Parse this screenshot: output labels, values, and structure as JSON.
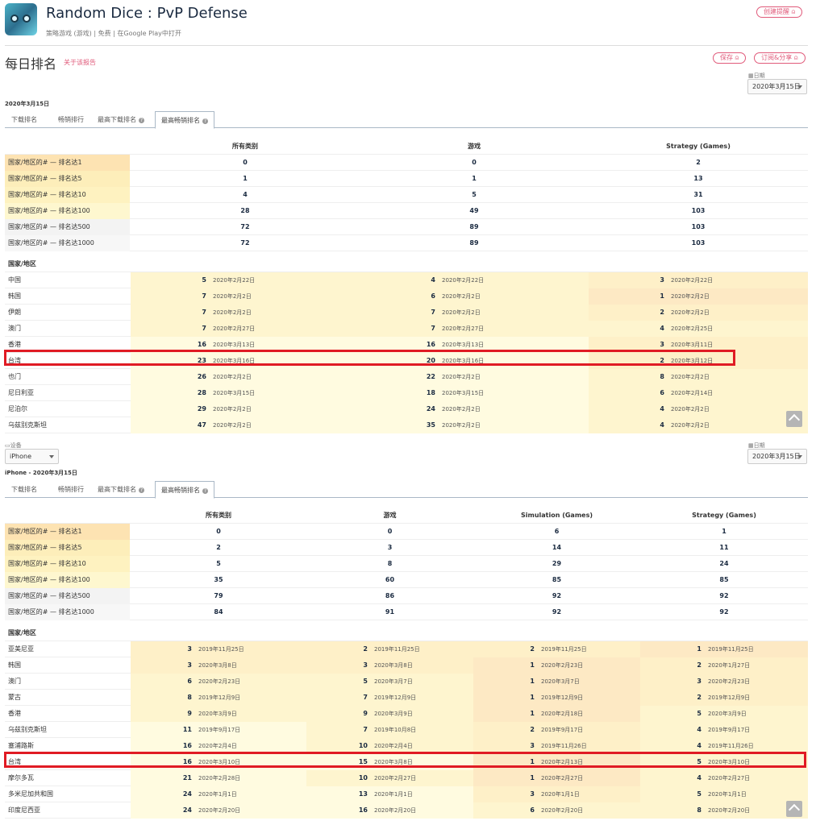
{
  "app": {
    "title": "Random Dice : PvP Defense",
    "category": "策略游戏 (游戏)",
    "price": "免费",
    "store_link": "在Google Play中打开",
    "create_alert": "创建提醒 ⍝"
  },
  "page": {
    "title": "每日排名",
    "about": "关于该报告",
    "save": "保存 ⍝",
    "subscribe": "订阅&分享 ⍝",
    "date_label": "日期",
    "date_value": "2020年3月15日"
  },
  "colors": {
    "accent": "#e05a7a",
    "highlight_box": "#e01b24"
  },
  "tab_labels": [
    "下载排名",
    "畅销排行",
    "最高下载排名",
    "最高畅销排名"
  ],
  "section1": {
    "date": "2020年3月15日",
    "headers": [
      "所有类别",
      "游戏",
      "Strategy (Games)"
    ],
    "summary": [
      {
        "label": "国家/地区的# — 排名达1",
        "values": [
          "0",
          "0",
          "2"
        ]
      },
      {
        "label": "国家/地区的# — 排名达5",
        "values": [
          "1",
          "1",
          "13"
        ]
      },
      {
        "label": "国家/地区的# — 排名达10",
        "values": [
          "4",
          "5",
          "31"
        ]
      },
      {
        "label": "国家/地区的# — 排名达100",
        "values": [
          "28",
          "49",
          "103"
        ]
      },
      {
        "label": "国家/地区的# — 排名达500",
        "values": [
          "72",
          "89",
          "103"
        ]
      },
      {
        "label": "国家/地区的# — 排名达1000",
        "values": [
          "72",
          "89",
          "103"
        ]
      }
    ],
    "country_label": "国家/地区",
    "countries": [
      {
        "name": "中国",
        "cells": [
          [
            "5",
            "2020年2月22日"
          ],
          [
            "4",
            "2020年2月22日"
          ],
          [
            "3",
            "2020年2月22日"
          ]
        ]
      },
      {
        "name": "韩国",
        "cells": [
          [
            "7",
            "2020年2月2日"
          ],
          [
            "6",
            "2020年2月2日"
          ],
          [
            "1",
            "2020年2月2日"
          ]
        ]
      },
      {
        "name": "伊朗",
        "cells": [
          [
            "7",
            "2020年2月2日"
          ],
          [
            "7",
            "2020年2月2日"
          ],
          [
            "2",
            "2020年2月2日"
          ]
        ]
      },
      {
        "name": "澳门",
        "cells": [
          [
            "7",
            "2020年2月27日"
          ],
          [
            "7",
            "2020年2月27日"
          ],
          [
            "4",
            "2020年2月25日"
          ]
        ]
      },
      {
        "name": "香港",
        "cells": [
          [
            "16",
            "2020年3月13日"
          ],
          [
            "16",
            "2020年3月13日"
          ],
          [
            "3",
            "2020年3月11日"
          ]
        ]
      },
      {
        "name": "台湾",
        "cells": [
          [
            "23",
            "2020年3月16日"
          ],
          [
            "20",
            "2020年3月16日"
          ],
          [
            "2",
            "2020年3月12日"
          ]
        ]
      },
      {
        "name": "也门",
        "cells": [
          [
            "26",
            "2020年2月2日"
          ],
          [
            "22",
            "2020年2月2日"
          ],
          [
            "8",
            "2020年2月2日"
          ]
        ]
      },
      {
        "name": "尼日利亚",
        "cells": [
          [
            "28",
            "2020年3月15日"
          ],
          [
            "18",
            "2020年3月15日"
          ],
          [
            "6",
            "2020年2月14日"
          ]
        ]
      },
      {
        "name": "尼泊尔",
        "cells": [
          [
            "29",
            "2020年2月2日"
          ],
          [
            "24",
            "2020年2月2日"
          ],
          [
            "4",
            "2020年2月2日"
          ]
        ]
      },
      {
        "name": "乌兹别克斯坦",
        "cells": [
          [
            "47",
            "2020年2月2日"
          ],
          [
            "35",
            "2020年2月2日"
          ],
          [
            "4",
            "2020年2月2日"
          ]
        ]
      }
    ]
  },
  "section2": {
    "device_label": "设备",
    "device_value": "iPhone",
    "date_label": "日期",
    "date_value": "2020年3月15日",
    "caption": "iPhone - 2020年3月15日",
    "headers": [
      "所有类别",
      "游戏",
      "Simulation (Games)",
      "Strategy (Games)"
    ],
    "summary": [
      {
        "label": "国家/地区的# — 排名达1",
        "values": [
          "0",
          "0",
          "6",
          "1"
        ]
      },
      {
        "label": "国家/地区的# — 排名达5",
        "values": [
          "2",
          "3",
          "14",
          "11"
        ]
      },
      {
        "label": "国家/地区的# — 排名达10",
        "values": [
          "5",
          "8",
          "29",
          "24"
        ]
      },
      {
        "label": "国家/地区的# — 排名达100",
        "values": [
          "35",
          "60",
          "85",
          "85"
        ]
      },
      {
        "label": "国家/地区的# — 排名达500",
        "values": [
          "79",
          "86",
          "92",
          "92"
        ]
      },
      {
        "label": "国家/地区的# — 排名达1000",
        "values": [
          "84",
          "91",
          "92",
          "92"
        ]
      }
    ],
    "country_label": "国家/地区",
    "countries": [
      {
        "name": "亚美尼亚",
        "cells": [
          [
            "3",
            "2019年11月25日"
          ],
          [
            "2",
            "2019年11月25日"
          ],
          [
            "2",
            "2019年11月25日"
          ],
          [
            "1",
            "2019年11月25日"
          ]
        ]
      },
      {
        "name": "韩国",
        "cells": [
          [
            "3",
            "2020年3月8日"
          ],
          [
            "3",
            "2020年3月8日"
          ],
          [
            "1",
            "2020年2月23日"
          ],
          [
            "2",
            "2020年1月27日"
          ]
        ]
      },
      {
        "name": "澳门",
        "cells": [
          [
            "6",
            "2020年2月23日"
          ],
          [
            "5",
            "2020年3月7日"
          ],
          [
            "1",
            "2020年3月7日"
          ],
          [
            "3",
            "2020年2月23日"
          ]
        ]
      },
      {
        "name": "蒙古",
        "cells": [
          [
            "8",
            "2019年12月9日"
          ],
          [
            "7",
            "2019年12月9日"
          ],
          [
            "1",
            "2019年12月9日"
          ],
          [
            "2",
            "2019年12月9日"
          ]
        ]
      },
      {
        "name": "香港",
        "cells": [
          [
            "9",
            "2020年3月9日"
          ],
          [
            "9",
            "2020年3月9日"
          ],
          [
            "1",
            "2020年2月18日"
          ],
          [
            "5",
            "2020年3月9日"
          ]
        ]
      },
      {
        "name": "乌兹别克斯坦",
        "cells": [
          [
            "11",
            "2019年9月17日"
          ],
          [
            "7",
            "2019年10月8日"
          ],
          [
            "2",
            "2019年9月17日"
          ],
          [
            "4",
            "2019年9月17日"
          ]
        ]
      },
      {
        "name": "塞浦路斯",
        "cells": [
          [
            "16",
            "2020年2月4日"
          ],
          [
            "10",
            "2020年2月4日"
          ],
          [
            "3",
            "2019年11月26日"
          ],
          [
            "4",
            "2019年11月26日"
          ]
        ]
      },
      {
        "name": "台湾",
        "cells": [
          [
            "16",
            "2020年3月10日"
          ],
          [
            "15",
            "2020年3月8日"
          ],
          [
            "1",
            "2020年2月13日"
          ],
          [
            "5",
            "2020年3月10日"
          ]
        ]
      },
      {
        "name": "摩尔多瓦",
        "cells": [
          [
            "21",
            "2020年2月28日"
          ],
          [
            "10",
            "2020年2月27日"
          ],
          [
            "1",
            "2020年2月27日"
          ],
          [
            "4",
            "2020年2月27日"
          ]
        ]
      },
      {
        "name": "多米尼加共和国",
        "cells": [
          [
            "24",
            "2020年1月1日"
          ],
          [
            "13",
            "2020年1月1日"
          ],
          [
            "3",
            "2020年1月1日"
          ],
          [
            "5",
            "2020年1月1日"
          ]
        ]
      },
      {
        "name": "印度尼西亚",
        "cells": [
          [
            "24",
            "2020年2月20日"
          ],
          [
            "16",
            "2020年2月20日"
          ],
          [
            "6",
            "2020年2月20日"
          ],
          [
            "8",
            "2020年2月20日"
          ]
        ]
      }
    ]
  }
}
